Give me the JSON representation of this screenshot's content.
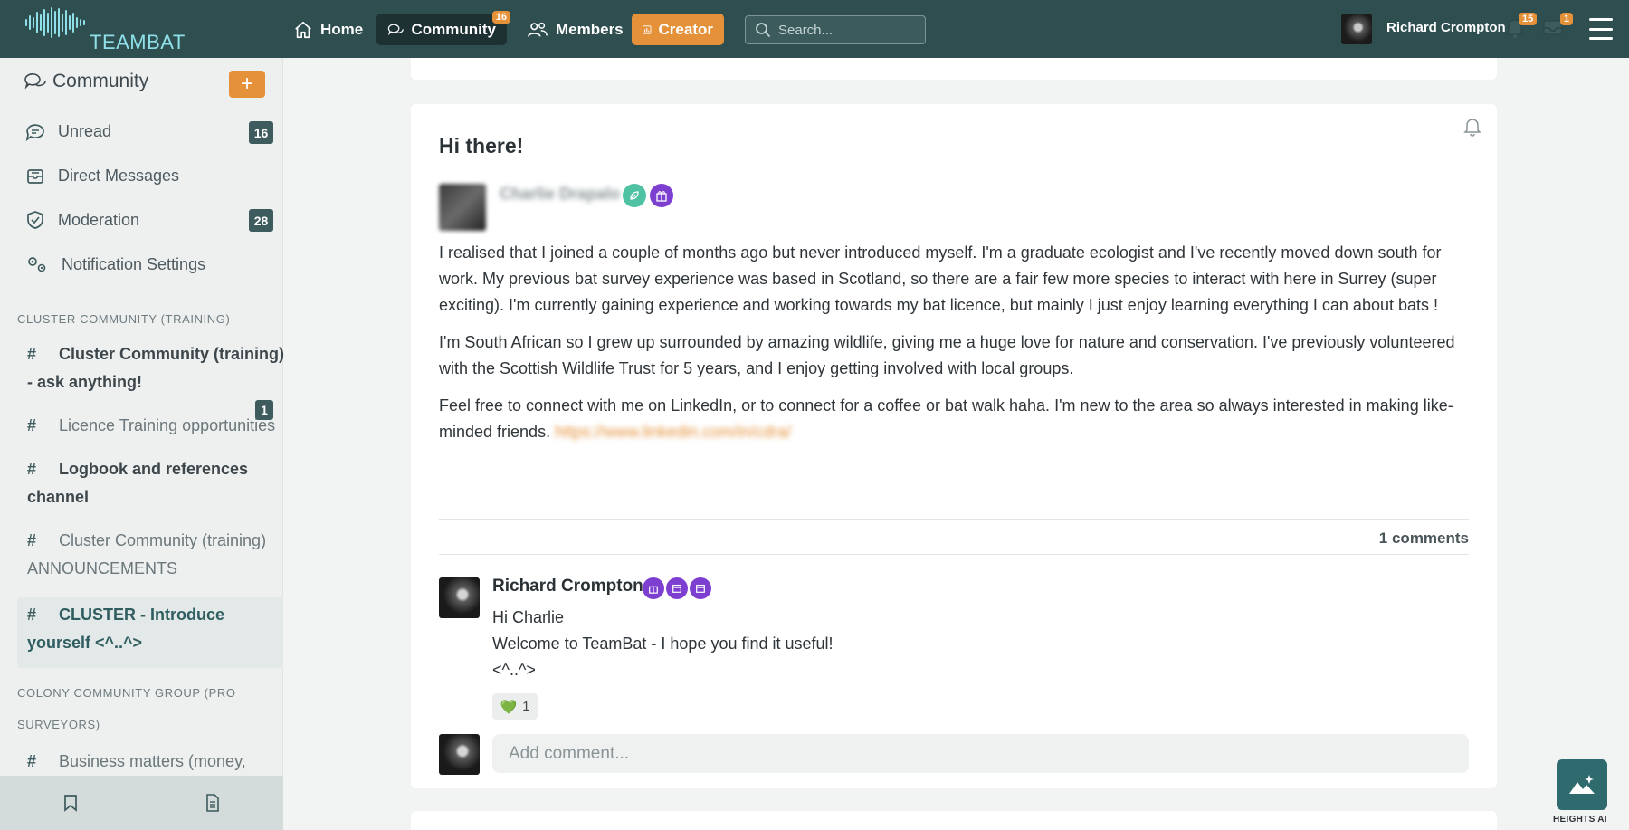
{
  "topbar": {
    "brand": "TEAMBAT",
    "nav": {
      "home": "Home",
      "community": "Community",
      "community_badge": "16",
      "members": "Members",
      "creator": "Creator"
    },
    "search_placeholder": "Search...",
    "user_name": "Richard Crompton",
    "notifications_badge": "15",
    "messages_badge": "1"
  },
  "sidebar": {
    "title": "Community",
    "links": {
      "unread": "Unread",
      "unread_count": "16",
      "direct_messages": "Direct Messages",
      "moderation": "Moderation",
      "moderation_count": "28",
      "notification_settings": "Notification Settings"
    },
    "section1": "CLUSTER COMMUNITY (TRAINING)",
    "channels1": [
      "Cluster Community (training) - ask anything!",
      "Licence Training opportunities",
      "Logbook and references channel",
      "Cluster Community (training) ANNOUNCEMENTS",
      "CLUSTER - Introduce yourself <^..^>"
    ],
    "channel1_unread": "1",
    "section2": "COLONY COMMUNITY GROUP (PRO SURVEYORS)",
    "channels2": [
      "Business matters (money,"
    ]
  },
  "post": {
    "title": "Hi there!",
    "author": "Charlie Drapalo",
    "paragraphs": [
      "I realised that I joined a couple of months ago but never introduced myself. I'm a graduate ecologist and I've recently moved down south for work. My previous bat survey experience was based in Scotland, so there are a fair few more species to interact with here in Surrey (super exciting). I'm currently gaining experience and working towards my bat licence, but mainly I just enjoy learning everything I can about bats !",
      "I'm South African so I grew up surrounded by amazing wildlife, giving me a huge love for nature and conservation. I've previously volunteered with the Scottish Wildlife Trust for 5 years, and I enjoy getting involved with local groups.",
      "Feel free to connect with me on LinkedIn, or to connect for a coffee or bat walk haha. I'm new to the area so always interested in making like-minded friends."
    ],
    "link_text": "https://www.linkedin.com/in/cdra/",
    "comments_count": "1 comments",
    "comment": {
      "author": "Richard Crompton",
      "lines": [
        "Hi Charlie",
        "Welcome to TeamBat - I hope you find it useful!",
        "<^..^>"
      ],
      "reaction_emoji": "💚",
      "reaction_count": "1"
    },
    "add_comment_placeholder": "Add comment..."
  },
  "heights_label": "HEIGHTS AI",
  "colors": {
    "topbar": "#2f4e50",
    "accent": "#e4913a",
    "badge_dark": "#3e5b5d"
  }
}
